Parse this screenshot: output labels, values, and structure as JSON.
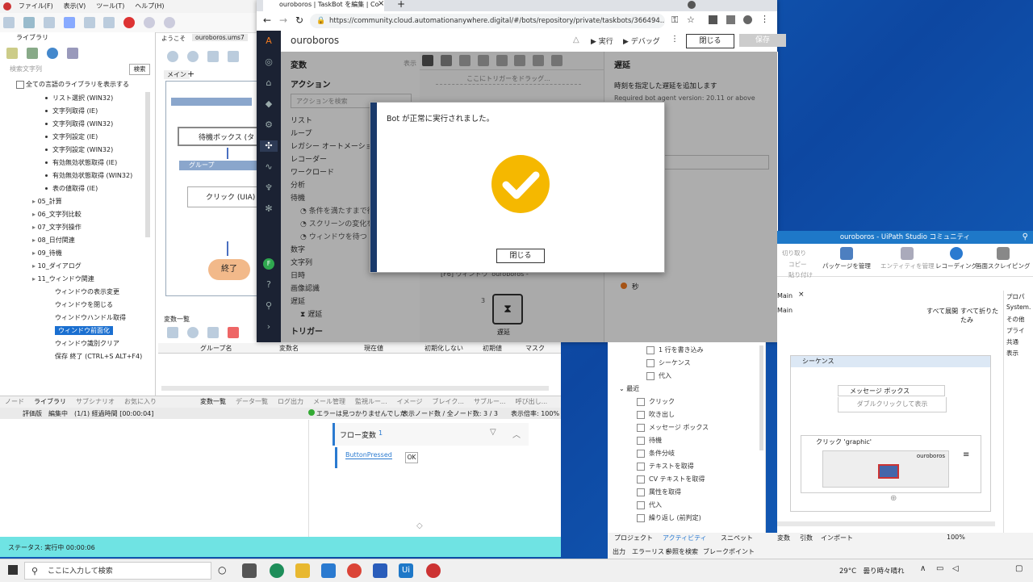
{
  "left_app": {
    "menu": [
      "ファイル(F)",
      "表示(V)",
      "ツール(T)",
      "ヘルプ(H)"
    ],
    "library_tab": "ライブラリ",
    "search_placeholder": "検索文字列",
    "search_button": "検索",
    "show_all_lang": "全ての言語のライブラリを表示する",
    "tabs": [
      "ようこそ",
      "ouroboros.ums7"
    ],
    "main_tab": "メイン",
    "tree": [
      {
        "label": "リスト選択 (WIN32)",
        "level": 2
      },
      {
        "label": "文字列取得 (IE)",
        "level": 2
      },
      {
        "label": "文字列取得 (WIN32)",
        "level": 2
      },
      {
        "label": "文字列設定 (IE)",
        "level": 2
      },
      {
        "label": "文字列設定 (WIN32)",
        "level": 2
      },
      {
        "label": "有効無効状態取得 (IE)",
        "level": 2
      },
      {
        "label": "有効無効状態取得 (WIN32)",
        "level": 2
      },
      {
        "label": "表の値取得 (IE)",
        "level": 2
      },
      {
        "label": "05_計算",
        "level": 1
      },
      {
        "label": "06_文字列比較",
        "level": 1
      },
      {
        "label": "07_文字列操作",
        "level": 1
      },
      {
        "label": "08_日付関連",
        "level": 1
      },
      {
        "label": "09_待機",
        "level": 1
      },
      {
        "label": "10_ダイアログ",
        "level": 1
      },
      {
        "label": "11_ウィンドウ関連",
        "level": 1
      },
      {
        "label": "ウィンドウの表示変更",
        "level": 3
      },
      {
        "label": "ウィンドウを閉じる",
        "level": 3
      },
      {
        "label": "ウィンドウハンドル取得",
        "level": 3
      },
      {
        "label": "ウィンドウ前面化",
        "level": 3,
        "selected": true
      },
      {
        "label": "ウィンドウ識別クリア",
        "level": 3
      },
      {
        "label": "保存 終了 (CTRL+S ALT+F4)",
        "level": 3
      }
    ],
    "flow": {
      "wait_box": "待機ボックス (タ",
      "group": "グループ",
      "click": "クリック (UIA)",
      "end": "終了"
    },
    "vars_title": "変数一覧",
    "vars_columns": [
      "グループ名",
      "変数名",
      "現在値",
      "初期化しない",
      "初期値",
      "マスク"
    ],
    "bottom_tabs": [
      "ノード",
      "ライブラリ",
      "サブシナリオ",
      "お気に入り"
    ],
    "bottom_tabs2": [
      "変数一覧",
      "データ一覧",
      "ログ出力",
      "メール管理",
      "監視ルー...",
      "イメージ",
      "ブレイク...",
      "サブルー...",
      "呼び出し...",
      "実行時間"
    ],
    "status_left": "評価版　編集中　(1/1) 経過時間 [00:00:04]",
    "status_mid": "エラーは見つかりませんでした",
    "status_right": "表示ノード数 / 全ノード数: 3 / 3　　表示倍率: 100%",
    "flow_vars": "フロー変数",
    "flow_vars_count": "1",
    "button_pressed": "ButtonPressed",
    "ok": "OK",
    "run_status": "ステータス: 実行中 00:00:06"
  },
  "browser": {
    "tab_title": "ouroboros | TaskBot を編集 | Co",
    "url": "https://community.cloud.automationanywhere.digital/#/bots/repository/private/taskbots/366494...",
    "bot_name": "ouroboros",
    "run": "実行",
    "debug": "デバッグ",
    "close": "閉じる",
    "save": "保存",
    "variables": "変数",
    "show": "表示",
    "actions": "アクション",
    "action_search": "アクションを検索",
    "action_items": [
      "リスト",
      "ループ",
      "レガシー オートメーション",
      "レコーダー",
      "ワークロード",
      "分析",
      "待機"
    ],
    "wait_items": [
      "条件を満たすまで待機",
      "スクリーンの変化を待つ",
      "ウィンドウを待つ"
    ],
    "action_items2": [
      "数字",
      "文字列",
      "日時",
      "画像認識",
      "遅延"
    ],
    "delay_sub": "遅延",
    "trigger": "トリガー",
    "trigger_drop": "ここにトリガーをドラッグ...",
    "canvas_node": "[F6] ウィンドウ 'ouroboros -",
    "canvas_delay": "遅延",
    "step_no": "3",
    "right_title": "遅延",
    "right_desc": "時刻を指定した遅延を追加します",
    "right_req": "Required bot agent version: 20.11 or above",
    "seconds": "秒"
  },
  "dialog": {
    "message": "Bot が正常に実行されました。",
    "close": "閉じる"
  },
  "uipath": {
    "title": "ouroboros - UiPath Studio コミュニティ",
    "ribbon_small": [
      "切り取り",
      "コピー",
      "貼り付け"
    ],
    "ribbon": [
      "パッケージを管理",
      "エンティティを管理",
      "レコーディング",
      "画面スクレイピング"
    ],
    "tab_main": "Main",
    "breadcrumb": "Main",
    "expand_all": "すべて展開",
    "collapse_all": "すべて折りたたみ",
    "activities_top": [
      "1 行を書き込み",
      "シーケンス",
      "代入"
    ],
    "recent": "最近",
    "activities": [
      "クリック",
      "吹き出し",
      "メッセージ ボックス",
      "待機",
      "条件分岐",
      "テキストを取得",
      "CV テキストを取得",
      "属性を取得",
      "代入",
      "繰り返し (前判定)"
    ],
    "sequence": "シーケンス",
    "message_box": "メッセージ ボックス",
    "double_click": "ダブルクリックして表示",
    "click_graphic": "クリック 'graphic'",
    "ouroboros": "ouroboros",
    "props": [
      "プロパ",
      "System.",
      "その他",
      "プライ",
      "共通",
      "表示"
    ],
    "bottom_tabs": [
      "プロジェクト",
      "アクティビティ",
      "スニペット"
    ],
    "bottom_tabs2": [
      "出力",
      "エラーリスト",
      "参照を検索",
      "ブレークポイント"
    ],
    "designer_tabs": [
      "変数",
      "引数",
      "インポート"
    ],
    "zoom": "100%"
  },
  "taskbar": {
    "search": "ここに入力して検索",
    "weather": "29°C　曇り時々晴れ",
    "accent": "#f5b800"
  }
}
